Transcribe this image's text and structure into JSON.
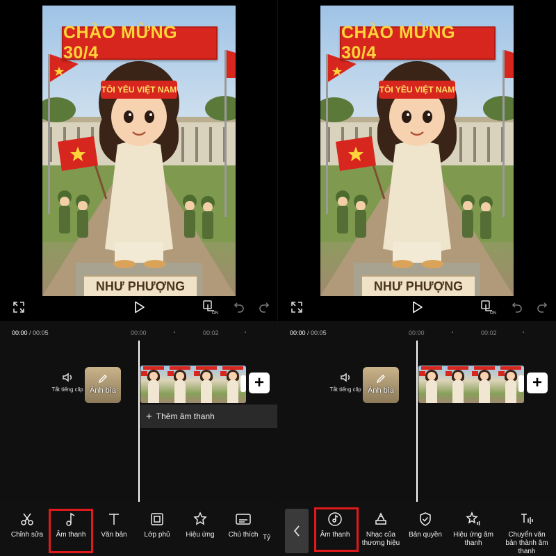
{
  "preview": {
    "banner_text": "CHÀO MỪNG 30/4",
    "headband_text": "TÔI YÊU VIỆT NAM",
    "plaque_text": "NHƯ PHƯỢNG"
  },
  "timeline": {
    "current_time": "00:00",
    "total_time": "/ 00:05",
    "tick_0": "00:00",
    "tick_2": "00:02",
    "mute_label": "Tắt tiếng clip",
    "cover_label": "Ảnh bìa",
    "add_audio_label": "Thêm âm thanh",
    "add_symbol": "+"
  },
  "left_toolbar": [
    {
      "label": "Chỉnh sửa",
      "icon": "scissors-icon"
    },
    {
      "label": "Âm thanh",
      "icon": "music-note-icon"
    },
    {
      "label": "Văn bản",
      "icon": "text-icon"
    },
    {
      "label": "Lớp phủ",
      "icon": "overlay-icon"
    },
    {
      "label": "Hiệu ứng",
      "icon": "sparkle-star-icon"
    },
    {
      "label": "Chú thích",
      "icon": "caption-icon"
    },
    {
      "label": "Tỷ",
      "icon": ""
    }
  ],
  "right_toolbar": [
    {
      "label": "Âm thanh",
      "icon": "music-disc-icon"
    },
    {
      "label": "Nhạc của thương hiệu",
      "icon": "brand-music-icon"
    },
    {
      "label": "Bản quyền",
      "icon": "shield-check-icon"
    },
    {
      "label": "Hiệu ứng âm thanh",
      "icon": "sound-effect-icon"
    },
    {
      "label": "Chuyển văn bản thành âm thanh",
      "icon": "text-to-speech-icon"
    }
  ],
  "colors": {
    "highlight": "#e0191a",
    "banner_red": "#d7261e",
    "banner_text": "#ffd43b"
  }
}
